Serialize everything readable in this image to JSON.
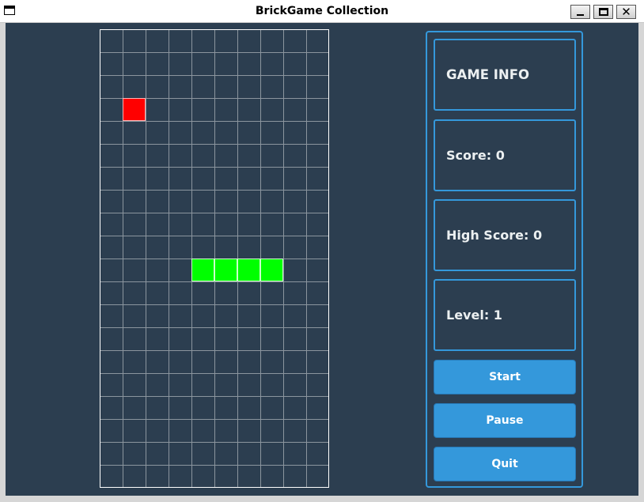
{
  "window": {
    "title": "BrickGame Collection",
    "min_glyph": "",
    "close_glyph": "✕"
  },
  "board": {
    "columns": 10,
    "rows": 20,
    "cells": [
      {
        "row": 3,
        "col": 1,
        "color": "#ff0000",
        "border": "#ffb3b3",
        "kind": "food"
      },
      {
        "row": 10,
        "col": 4,
        "color": "#00ff00",
        "border": "#ccffcc",
        "kind": "snake"
      },
      {
        "row": 10,
        "col": 5,
        "color": "#00ff00",
        "border": "#ccffcc",
        "kind": "snake"
      },
      {
        "row": 10,
        "col": 6,
        "color": "#00ff00",
        "border": "#ccffcc",
        "kind": "snake"
      },
      {
        "row": 10,
        "col": 7,
        "color": "#00ff00",
        "border": "#ccffcc",
        "kind": "snake"
      }
    ]
  },
  "info": {
    "title": "GAME INFO",
    "score": "Score: 0",
    "high_score": "High Score: 0",
    "level": "Level: 1"
  },
  "buttons": {
    "start": "Start",
    "pause": "Pause",
    "quit": "Quit"
  },
  "colors": {
    "background": "#2c3e50",
    "accent": "#3498db",
    "text": "#ecf0f1",
    "grid_line": "#8b959e"
  }
}
